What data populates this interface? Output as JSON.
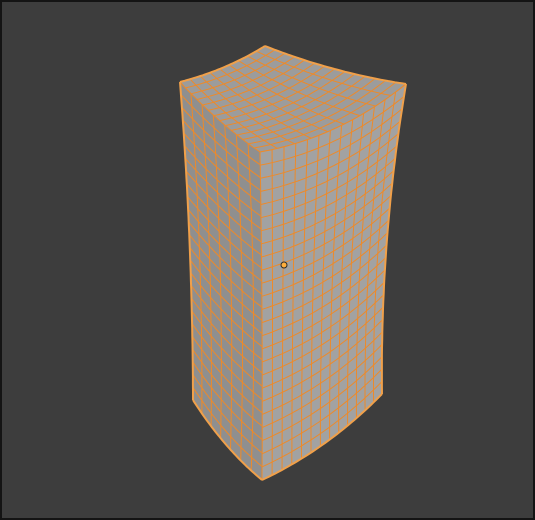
{
  "viewport": {
    "background": "#3d3d3d",
    "border": "#141414"
  },
  "mesh": {
    "object": "deformed-box",
    "state": "selected",
    "face_color": "#a7a7a7",
    "top_face_color": "#9c9c9c",
    "left_face_color": "#8f8f8f",
    "right_face_color": "#a2a2a2",
    "wire_color": "#ed8a2a",
    "outline_color": "#f0a04a",
    "origin_color": "#ffae3c"
  }
}
